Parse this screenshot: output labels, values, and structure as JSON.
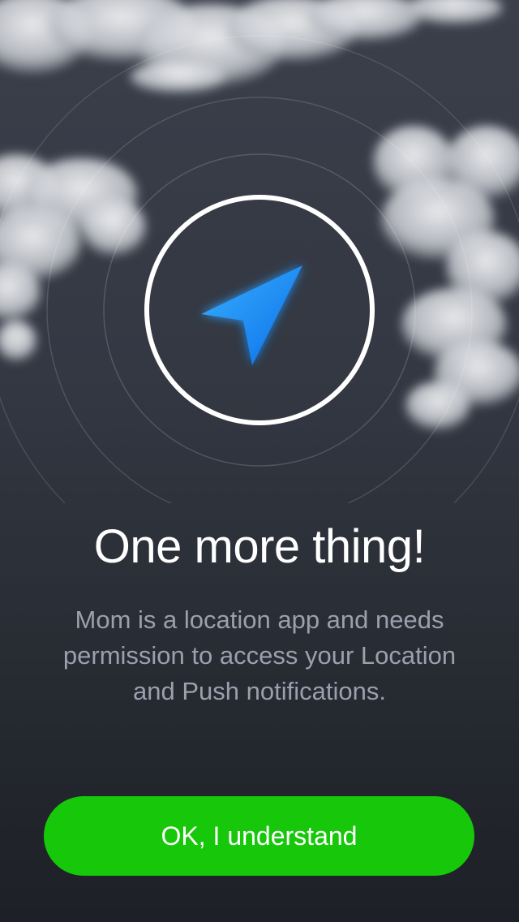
{
  "onboarding": {
    "headline": "One more thing!",
    "message": "Mom is a location app and needs permission to access your Location and Push notifications.",
    "button_label": "OK, I understand"
  },
  "icons": {
    "hero": "location-arrow-icon"
  },
  "colors": {
    "background_top": "#3b3f4a",
    "background_bottom": "#1d2026",
    "button": "#17c70a",
    "arrow": "#1f8fff",
    "message_text": "#9aa0ad"
  }
}
